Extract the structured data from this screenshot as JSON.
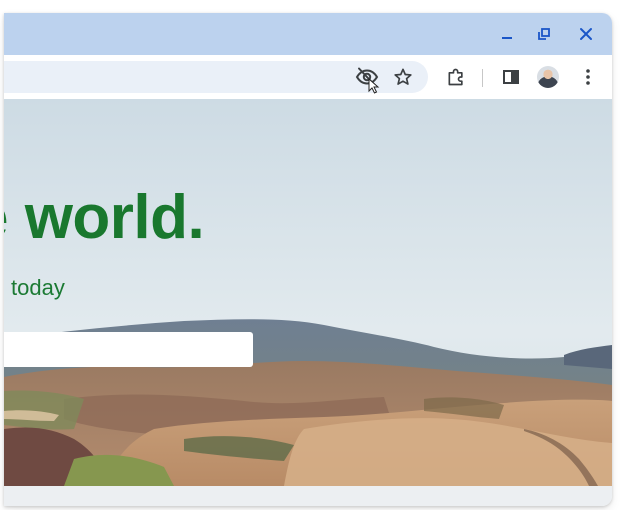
{
  "browser": {
    "colors": {
      "titlebar": "#bcd2ee",
      "omnibox": "#eaf0f8",
      "window_controls": "#1a56c8",
      "toolbar_icons": "#3c4043"
    },
    "window_controls": [
      "minimize-icon",
      "restore-icon",
      "close-icon"
    ],
    "toolbar_icons": [
      "eye-slash-icon",
      "star-icon",
      "extensions-puzzle-icon",
      "side-panel-icon",
      "avatar",
      "kebab-menu-icon"
    ]
  },
  "page": {
    "headline": "e world.",
    "subtext": "today",
    "colors": {
      "headline": "#19782e",
      "sky": "#d9e4ea"
    }
  }
}
